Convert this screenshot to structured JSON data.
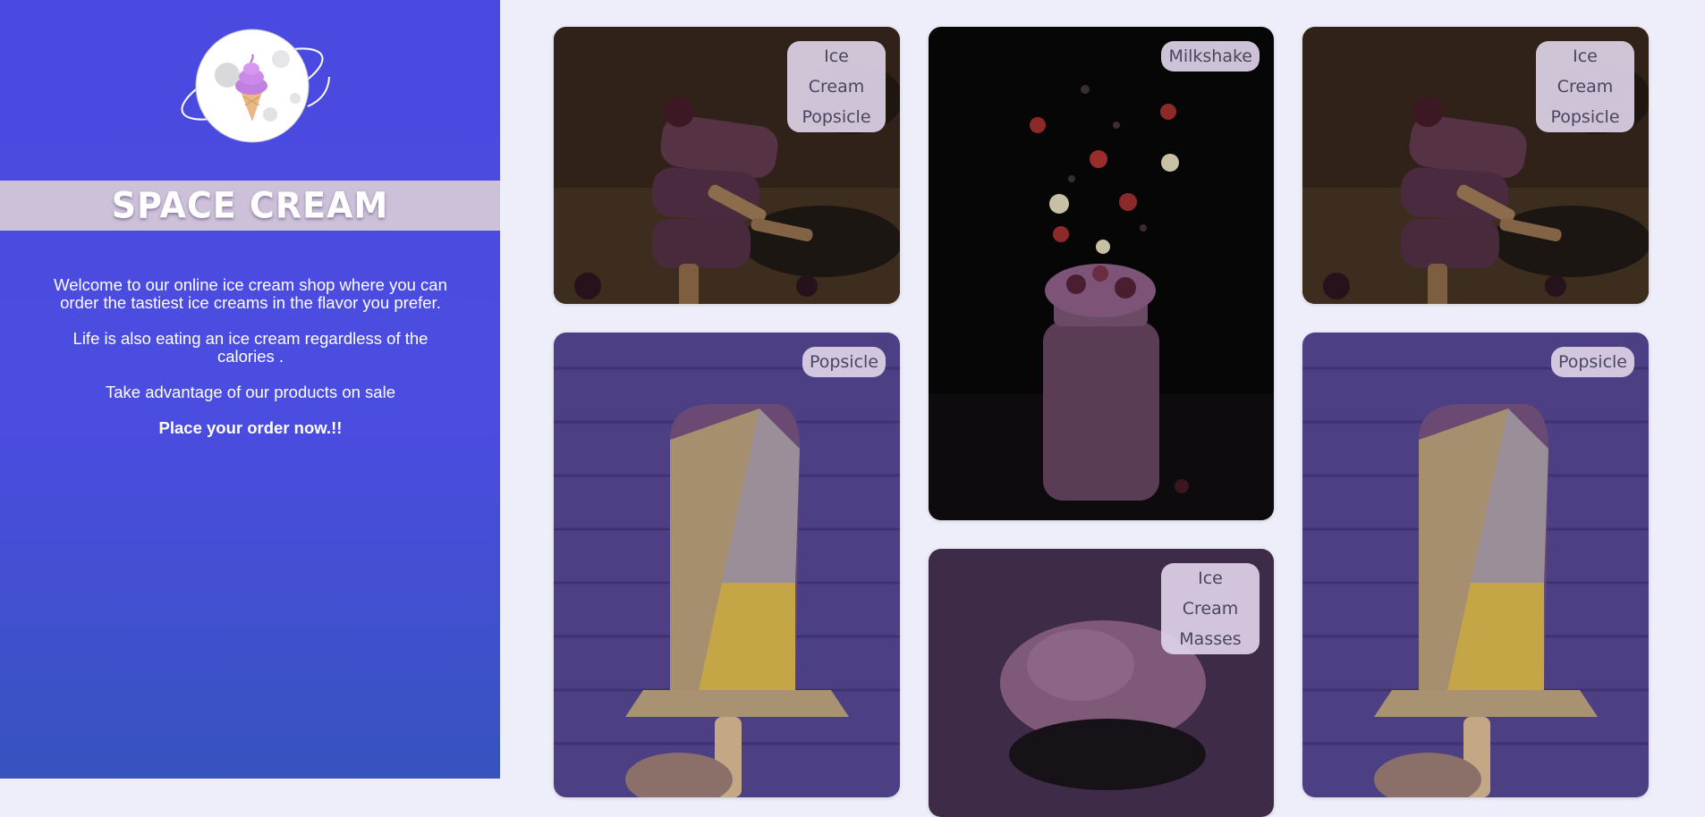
{
  "brand": {
    "name": "SPACE CREAM"
  },
  "colors": {
    "primary": "#4b4ae0",
    "band": "#cdc1d9",
    "background": "#eeeefa",
    "tag": "#ded2e8"
  },
  "intro": {
    "p1": "Welcome to our online ice cream shop where you can order the tastiest ice creams in the flavor you prefer.",
    "p2": "Life is also eating an ice cream regardless of the calories .",
    "p3": "Take advantage of our products on sale",
    "cta": "Place your order now.!!"
  },
  "products": [
    {
      "tag": "Ice Cream Popsicle",
      "image": "berry-popsicle-stack"
    },
    {
      "tag": "Milkshake",
      "image": "berry-milkshake-jar"
    },
    {
      "tag": "Ice Cream Popsicle",
      "image": "berry-popsicle-stack"
    },
    {
      "tag": "Popsicle",
      "image": "nut-coated-popsicle"
    },
    {
      "tag": "Ice Cream Masses",
      "image": "ice-cream-scoop"
    },
    {
      "tag": "Popsicle",
      "image": "nut-coated-popsicle"
    }
  ]
}
